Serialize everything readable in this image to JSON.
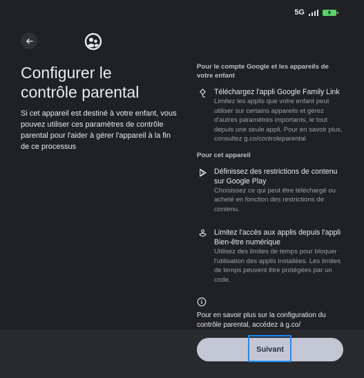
{
  "status_bar": {
    "network": "5G"
  },
  "header": {
    "back_icon": "arrow-left-icon",
    "app_icon": "family-link-icon"
  },
  "title": "Configurer le contrôle parental",
  "intro": "Si cet appareil est destiné à votre enfant, vous pouvez utiliser ces paramètres de contrôle parental pour l'aider à gérer l'appareil à la fin de ce processus",
  "sections": [
    {
      "heading": "Pour le compte Google et les appareils de votre enfant",
      "items": [
        {
          "icon": "diamond-hand-icon",
          "title": "Téléchargez l'appli Google Family Link",
          "description": "Limitez les applis que votre enfant peut utiliser sur certains appareils et gérez d'autres paramètres importants, le tout depuis une seule appli. Pour en savoir plus, consultez g.co/controleparental"
        }
      ]
    },
    {
      "heading": "Pour cet appareil",
      "items": [
        {
          "icon": "play-store-icon",
          "title": "Définissez des restrictions de contenu sur Google Play",
          "description": "Choisissez ce qui peut être téléchargé ou acheté en fonction des restrictions de contenu."
        },
        {
          "icon": "wellbeing-icon",
          "title": "Limitez l'accès aux applis depuis l'appli Bien-être numérique",
          "description": "Utilisez des limites de temps pour bloquer l'utilisation des applis installées. Les limites de temps peuvent être protégées par un code."
        }
      ]
    }
  ],
  "note": {
    "icon": "info-icon",
    "text": "Pour en savoir plus sur la configuration du contrôle parental, accédez à g.co/"
  },
  "next_button": {
    "label": "Suivant"
  },
  "colors": {
    "background": "#202124",
    "button": "#c3c6d4",
    "focus": "#1a8cff",
    "battery": "#5bd36b"
  }
}
